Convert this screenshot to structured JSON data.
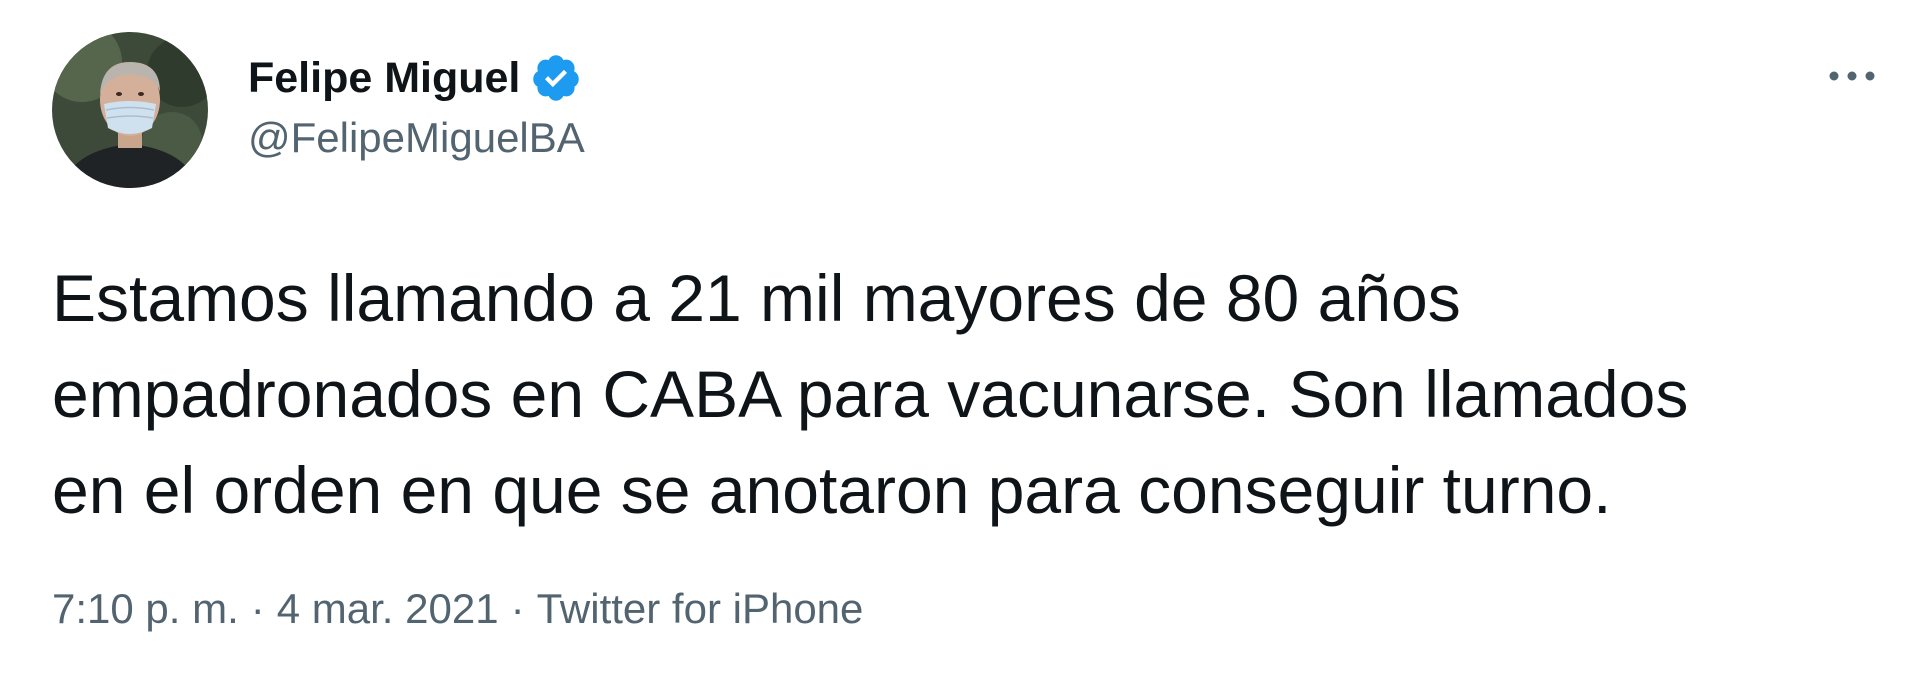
{
  "user": {
    "display_name": "Felipe Miguel",
    "handle": "@FelipeMiguelBA",
    "verified": true,
    "verified_icon": "verified-badge-icon",
    "verified_color": "#1d9bf0"
  },
  "more_icon": "more-horizontal-icon",
  "tweet": {
    "text_lines": [
      "Estamos llamando a 21 mil mayores de 80 años",
      "empadronados en CABA para vacunarse. Son llamados",
      "en el orden en que se anotaron para conseguir turno."
    ]
  },
  "meta": {
    "time": "7:10 p. m.",
    "separator": "·",
    "date": "4 mar. 2021",
    "source": "Twitter for iPhone"
  },
  "colors": {
    "text": "#0f1419",
    "secondary": "#536471",
    "accent": "#1d9bf0"
  }
}
